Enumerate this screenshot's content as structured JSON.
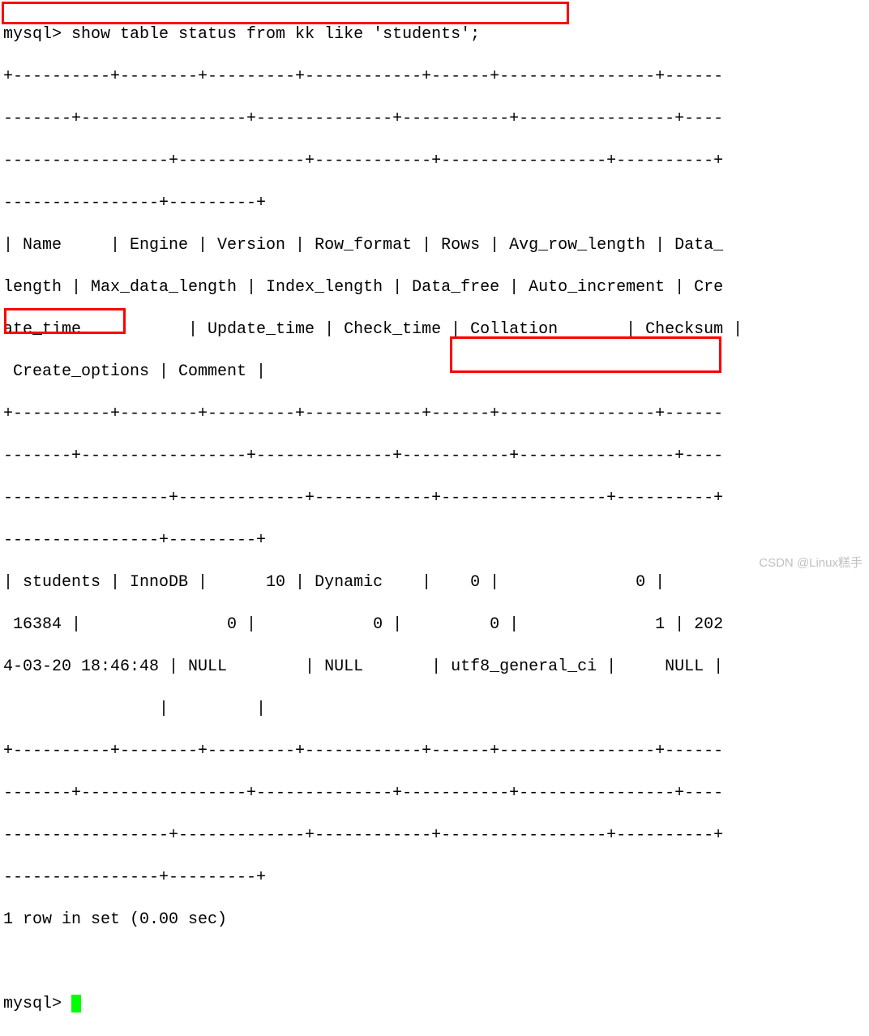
{
  "prompt_prefix": "mysql> ",
  "command": "show table status from kk like 'students';",
  "separator_lines": [
    "+----------+--------+---------+------------+------+----------------+------",
    "-------+-----------------+--------------+-----------+----------------+----",
    "-----------------+-------------+------------+-----------------+----------+",
    "----------------+---------+"
  ],
  "header_lines": [
    "| Name     | Engine | Version | Row_format | Rows | Avg_row_length | Data_",
    "length | Max_data_length | Index_length | Data_free | Auto_increment | Cre",
    "ate_time           | Update_time | Check_time | Collation       | Checksum |",
    " Create_options | Comment |"
  ],
  "data_lines": [
    "| students | InnoDB |      10 | Dynamic    |    0 |              0 |      ",
    " 16384 |               0 |            0 |         0 |              1 | 202",
    "4-03-20 18:46:48 | NULL        | NULL       | utf8_general_ci |     NULL |",
    "                |         |"
  ],
  "result_summary": "1 row in set (0.00 sec)",
  "prompt_end": "mysql> ",
  "watermark": "CSDN @Linux糕手",
  "table_data": {
    "Name": "students",
    "Engine": "InnoDB",
    "Version": "10",
    "Row_format": "Dynamic",
    "Rows": "0",
    "Avg_row_length": "0",
    "Data_length": "16384",
    "Max_data_length": "0",
    "Index_length": "0",
    "Data_free": "0",
    "Auto_increment": "1",
    "Create_time": "2024-03-20 18:46:48",
    "Update_time": "NULL",
    "Check_time": "NULL",
    "Collation": "utf8_general_ci",
    "Checksum": "NULL",
    "Create_options": "",
    "Comment": ""
  }
}
